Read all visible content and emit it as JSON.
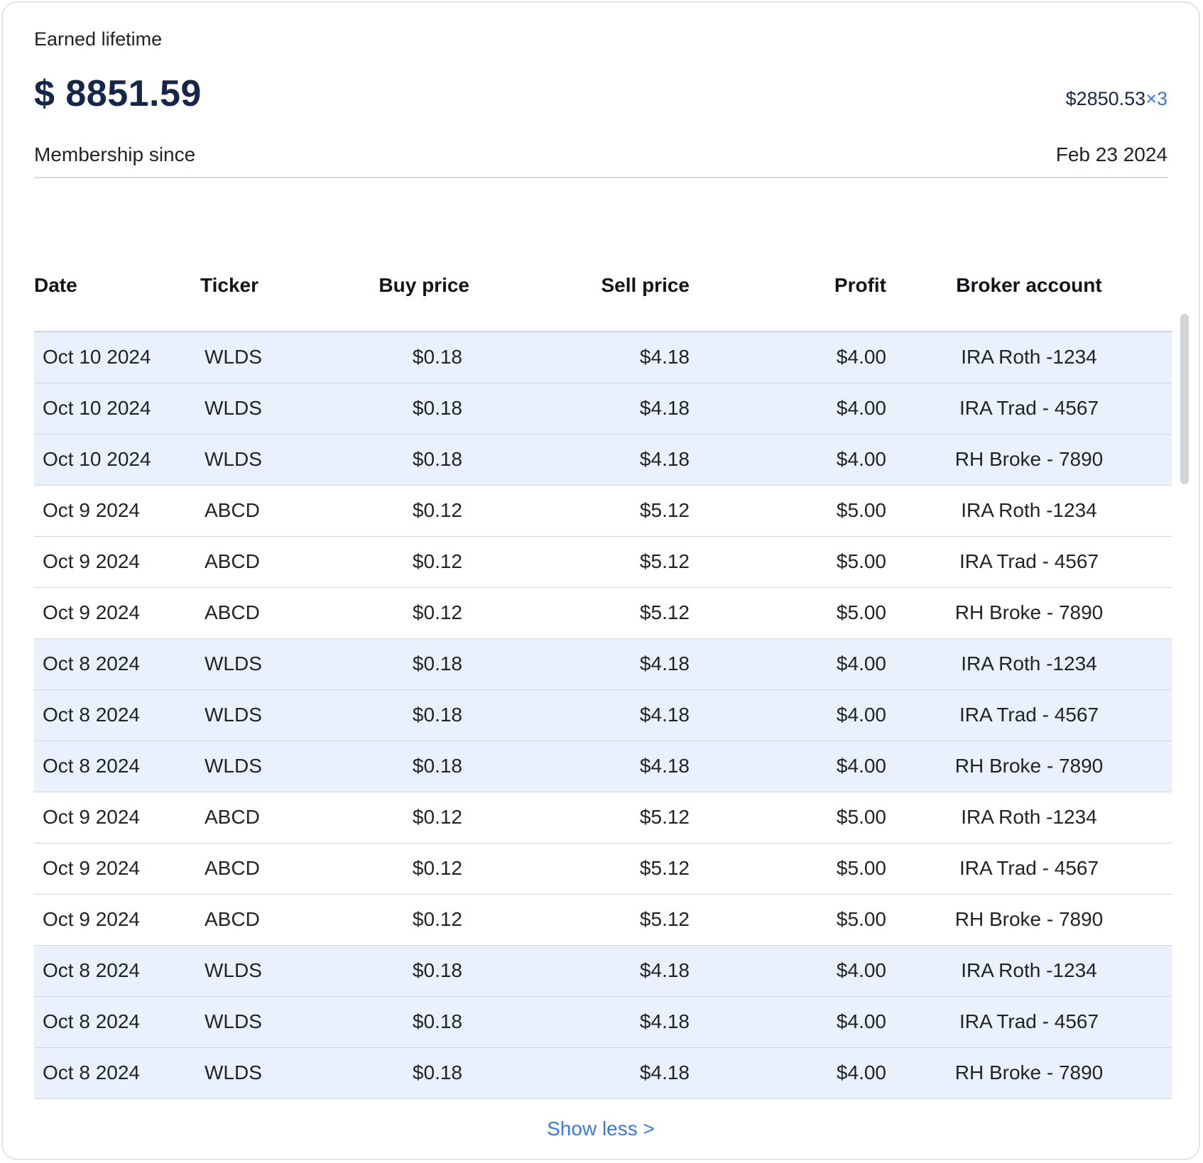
{
  "summary": {
    "earned_label": "Earned lifetime",
    "earned_amount": "$ 8851.59",
    "multiplier_amount": "$2850.53",
    "multiplier_factor": "×3",
    "membership_label": "Membership since",
    "membership_date": "Feb 23 2024"
  },
  "table": {
    "headers": {
      "date": "Date",
      "ticker": "Ticker",
      "buy_price": "Buy price",
      "sell_price": "Sell price",
      "profit": "Profit",
      "broker_account": "Broker account"
    },
    "rows": [
      {
        "date": "Oct 10 2024",
        "ticker": "WLDS",
        "buy": "$0.18",
        "sell": "$4.18",
        "profit": "$4.00",
        "broker": "IRA Roth -1234",
        "highlighted": true
      },
      {
        "date": "Oct 10 2024",
        "ticker": "WLDS",
        "buy": "$0.18",
        "sell": "$4.18",
        "profit": "$4.00",
        "broker": "IRA Trad - 4567",
        "highlighted": true
      },
      {
        "date": "Oct 10 2024",
        "ticker": "WLDS",
        "buy": "$0.18",
        "sell": "$4.18",
        "profit": "$4.00",
        "broker": "RH Broke - 7890",
        "highlighted": true
      },
      {
        "date": "Oct 9 2024",
        "ticker": "ABCD",
        "buy": "$0.12",
        "sell": "$5.12",
        "profit": "$5.00",
        "broker": "IRA Roth -1234",
        "highlighted": false
      },
      {
        "date": "Oct 9 2024",
        "ticker": "ABCD",
        "buy": "$0.12",
        "sell": "$5.12",
        "profit": "$5.00",
        "broker": "IRA Trad - 4567",
        "highlighted": false
      },
      {
        "date": "Oct 9 2024",
        "ticker": "ABCD",
        "buy": "$0.12",
        "sell": "$5.12",
        "profit": "$5.00",
        "broker": "RH Broke - 7890",
        "highlighted": false
      },
      {
        "date": "Oct 8 2024",
        "ticker": "WLDS",
        "buy": "$0.18",
        "sell": "$4.18",
        "profit": "$4.00",
        "broker": "IRA Roth -1234",
        "highlighted": true
      },
      {
        "date": "Oct 8 2024",
        "ticker": "WLDS",
        "buy": "$0.18",
        "sell": "$4.18",
        "profit": "$4.00",
        "broker": "IRA Trad - 4567",
        "highlighted": true
      },
      {
        "date": "Oct 8 2024",
        "ticker": "WLDS",
        "buy": "$0.18",
        "sell": "$4.18",
        "profit": "$4.00",
        "broker": "RH Broke - 7890",
        "highlighted": true
      },
      {
        "date": "Oct 9 2024",
        "ticker": "ABCD",
        "buy": "$0.12",
        "sell": "$5.12",
        "profit": "$5.00",
        "broker": "IRA Roth -1234",
        "highlighted": false
      },
      {
        "date": "Oct 9 2024",
        "ticker": "ABCD",
        "buy": "$0.12",
        "sell": "$5.12",
        "profit": "$5.00",
        "broker": "IRA Trad - 4567",
        "highlighted": false
      },
      {
        "date": "Oct 9 2024",
        "ticker": "ABCD",
        "buy": "$0.12",
        "sell": "$5.12",
        "profit": "$5.00",
        "broker": "RH Broke - 7890",
        "highlighted": false
      },
      {
        "date": "Oct 8 2024",
        "ticker": "WLDS",
        "buy": "$0.18",
        "sell": "$4.18",
        "profit": "$4.00",
        "broker": "IRA Roth -1234",
        "highlighted": true
      },
      {
        "date": "Oct 8 2024",
        "ticker": "WLDS",
        "buy": "$0.18",
        "sell": "$4.18",
        "profit": "$4.00",
        "broker": "IRA Trad - 4567",
        "highlighted": true
      },
      {
        "date": "Oct 8 2024",
        "ticker": "WLDS",
        "buy": "$0.18",
        "sell": "$4.18",
        "profit": "$4.00",
        "broker": "RH Broke - 7890",
        "highlighted": true
      }
    ]
  },
  "footer": {
    "show_less_label": "Show less >"
  },
  "colors": {
    "accent": "#3a78e0",
    "amount": "#14264a",
    "row_highlight": "#eaf1fd"
  }
}
